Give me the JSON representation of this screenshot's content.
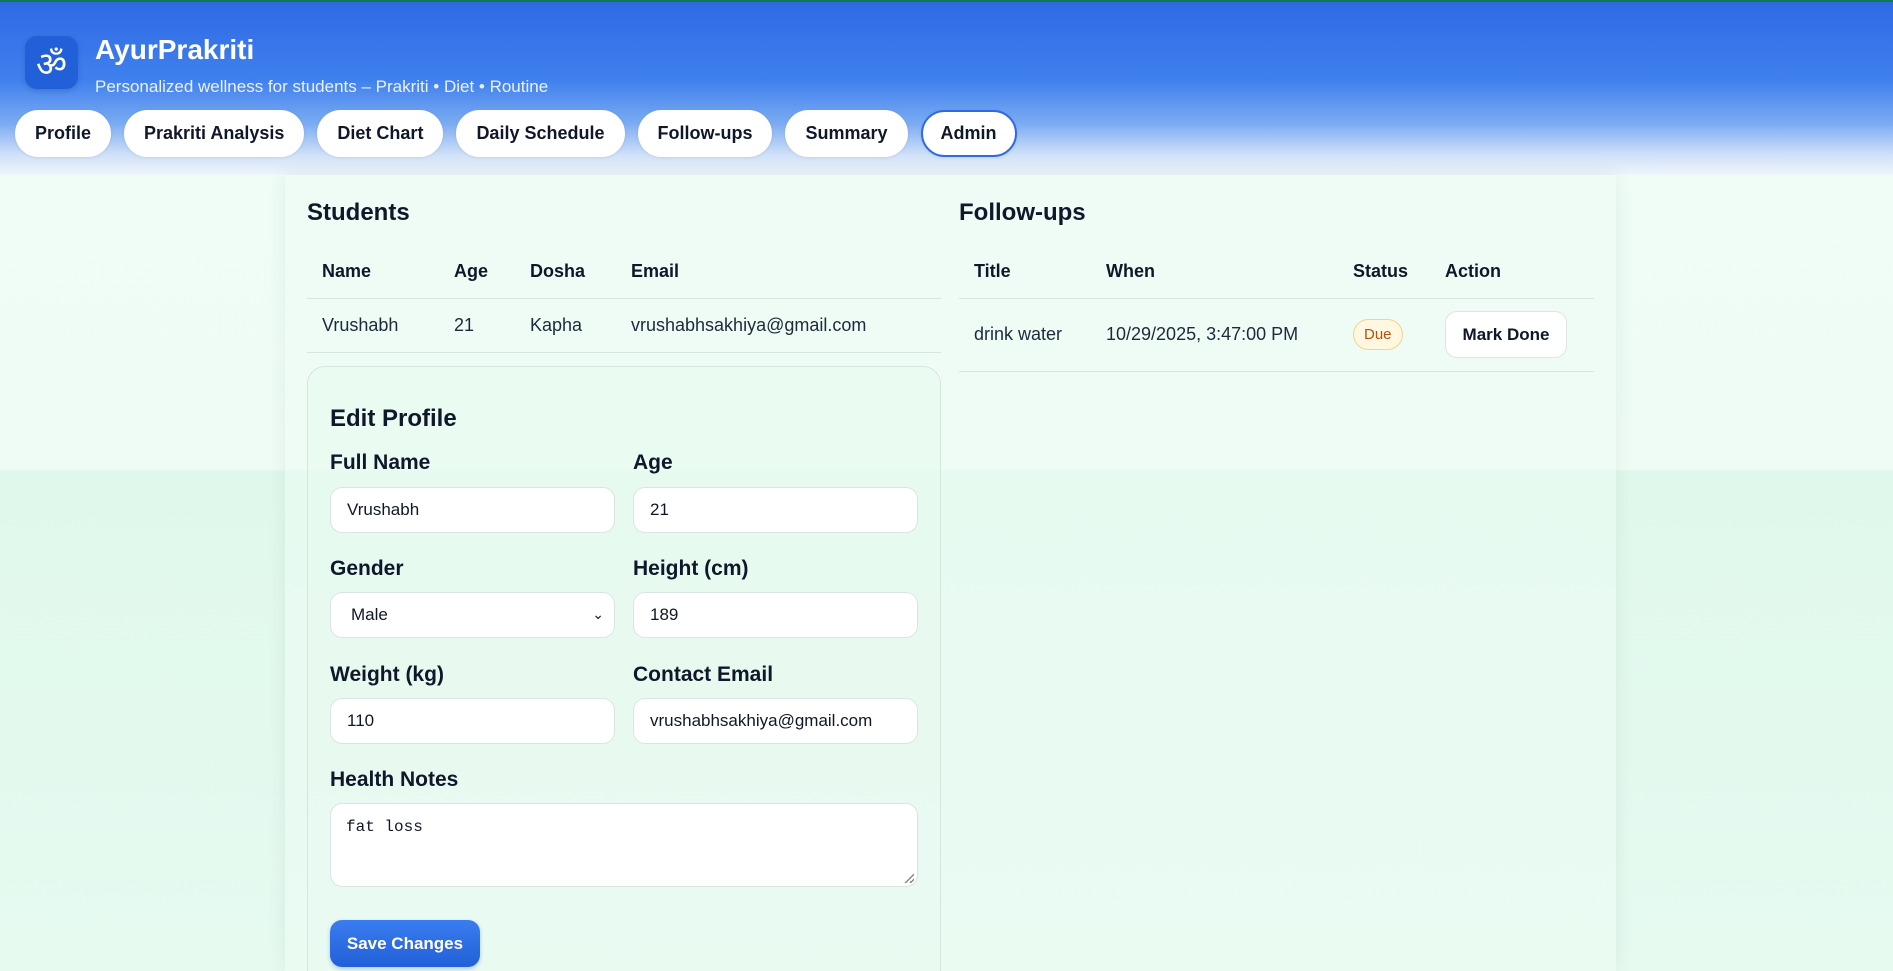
{
  "app": {
    "logo_glyph": "ॐ",
    "title": "AyurPrakriti",
    "subtitle": "Personalized wellness for students – Prakriti • Diet • Routine"
  },
  "nav": {
    "tabs": [
      {
        "label": "Profile",
        "active": false
      },
      {
        "label": "Prakriti Analysis",
        "active": false
      },
      {
        "label": "Diet Chart",
        "active": false
      },
      {
        "label": "Daily Schedule",
        "active": false
      },
      {
        "label": "Follow-ups",
        "active": false
      },
      {
        "label": "Summary",
        "active": false
      },
      {
        "label": "Admin",
        "active": true
      }
    ]
  },
  "students": {
    "title": "Students",
    "columns": [
      "Name",
      "Age",
      "Dosha",
      "Email"
    ],
    "rows": [
      {
        "name": "Vrushabh",
        "age": "21",
        "dosha": "Kapha",
        "email": "vrushabhsakhiya@gmail.com"
      }
    ]
  },
  "followups": {
    "title": "Follow-ups",
    "columns": [
      "Title",
      "When",
      "Status",
      "Action"
    ],
    "rows": [
      {
        "title": "drink water",
        "when": "10/29/2025, 3:47:00 PM",
        "status": "Due",
        "action": "Mark Done"
      }
    ]
  },
  "edit_profile": {
    "title": "Edit Profile",
    "full_name_label": "Full Name",
    "full_name_value": "Vrushabh",
    "age_label": "Age",
    "age_value": "21",
    "gender_label": "Gender",
    "gender_value": "Male",
    "height_label": "Height (cm)",
    "height_value": "189",
    "weight_label": "Weight (kg)",
    "weight_value": "110",
    "email_label": "Contact Email",
    "email_value": "vrushabhsakhiya@gmail.com",
    "notes_label": "Health Notes",
    "notes_value": "fat loss",
    "save_label": "Save Changes"
  },
  "colors": {
    "primary": "#2160d8",
    "header_top": "#2f6ae3",
    "badge_due": "#b45309",
    "background": "#f0fdf6"
  }
}
